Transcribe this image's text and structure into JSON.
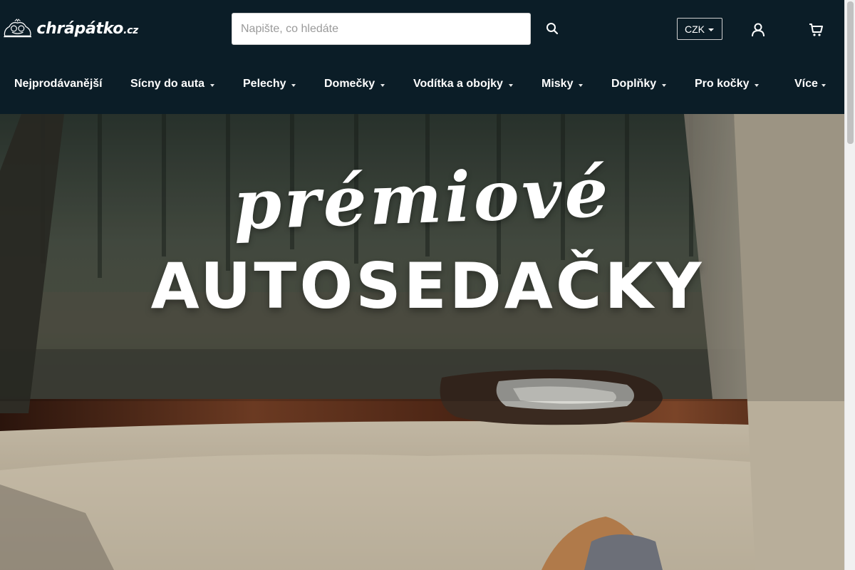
{
  "brand": {
    "name": "chrápátko",
    "tld": ".cz"
  },
  "search": {
    "placeholder": "Napište, co hledáte"
  },
  "currency": {
    "label": "CZK"
  },
  "nav": {
    "items": [
      {
        "label": "Nejprodávanější",
        "has_dropdown": false
      },
      {
        "label": "Sícny do auta",
        "has_dropdown": true
      },
      {
        "label": "Pelechy",
        "has_dropdown": true
      },
      {
        "label": "Domečky",
        "has_dropdown": true
      },
      {
        "label": "Vodítka a obojky",
        "has_dropdown": true
      },
      {
        "label": "Misky",
        "has_dropdown": true
      },
      {
        "label": "Doplňky",
        "has_dropdown": true
      },
      {
        "label": "Pro kočky",
        "has_dropdown": true
      },
      {
        "label": "Více",
        "has_dropdown": true
      }
    ]
  },
  "hero": {
    "script_text": "prémiové",
    "title": "AUTOSEDAČKY"
  },
  "icons": {
    "search": "search-icon",
    "login": "user-icon",
    "cart": "cart-icon",
    "logo": "sleeping-dogs-logo"
  },
  "colors": {
    "header_bg": "#0b1d27",
    "text": "#ffffff"
  }
}
